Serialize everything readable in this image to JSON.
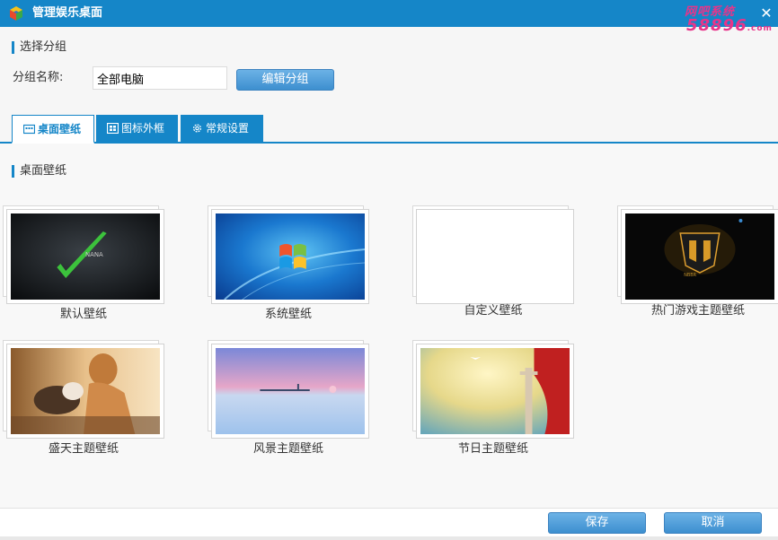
{
  "window": {
    "title": "管理娱乐桌面",
    "watermark_top": "网吧系统",
    "watermark_bottom": "58896",
    "watermark_com": ".com",
    "close_label": "✕"
  },
  "group_section": {
    "heading": "选择分组",
    "name_label": "分组名称:",
    "name_value": "全部电脑",
    "edit_button": "编辑分组"
  },
  "tabs": [
    {
      "label": "桌面壁纸",
      "icon": "wallpaper-icon",
      "active": true
    },
    {
      "label": "图标外框",
      "icon": "icon-frame-icon",
      "active": false
    },
    {
      "label": "常规设置",
      "icon": "gear-icon",
      "active": false
    }
  ],
  "wallpaper_section": {
    "heading": "桌面壁纸",
    "items": [
      {
        "label": "默认壁纸"
      },
      {
        "label": "系统壁纸"
      },
      {
        "label": "自定义壁纸"
      },
      {
        "label": "热门游戏主题壁纸"
      },
      {
        "label": "盛天主题壁纸"
      },
      {
        "label": "风景主题壁纸"
      },
      {
        "label": "节日主题壁纸"
      }
    ]
  },
  "footer": {
    "save_button": "保存",
    "cancel_button": "取消"
  },
  "colors": {
    "accent": "#1586c8",
    "watermark": "#e8348a",
    "check_green": "#3cc23c"
  }
}
